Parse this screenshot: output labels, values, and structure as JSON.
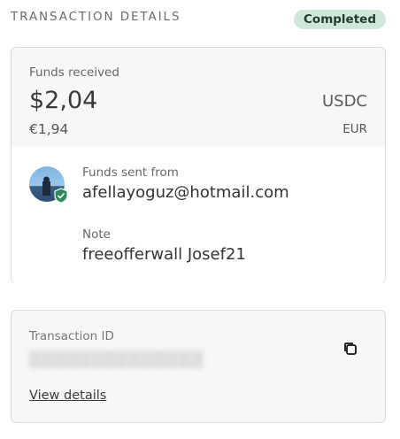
{
  "header": {
    "title": "TRANSACTION DETAILS",
    "status": "Completed",
    "status_color": "#cfe6d8"
  },
  "funds": {
    "label": "Funds received",
    "amount_usd": "$2,04",
    "currency_usd": "USDC",
    "amount_eur": "€1,94",
    "currency_eur": "EUR"
  },
  "sender": {
    "label": "Funds sent from",
    "email": "afellayoguz@hotmail.com",
    "avatar_icon": "user-photo",
    "badge_icon": "shield-check-icon"
  },
  "note": {
    "label": "Note",
    "text": "freeofferwall Josef21"
  },
  "transaction": {
    "label": "Transaction ID",
    "copy_icon": "copy-icon",
    "view_details_label": "View details"
  }
}
